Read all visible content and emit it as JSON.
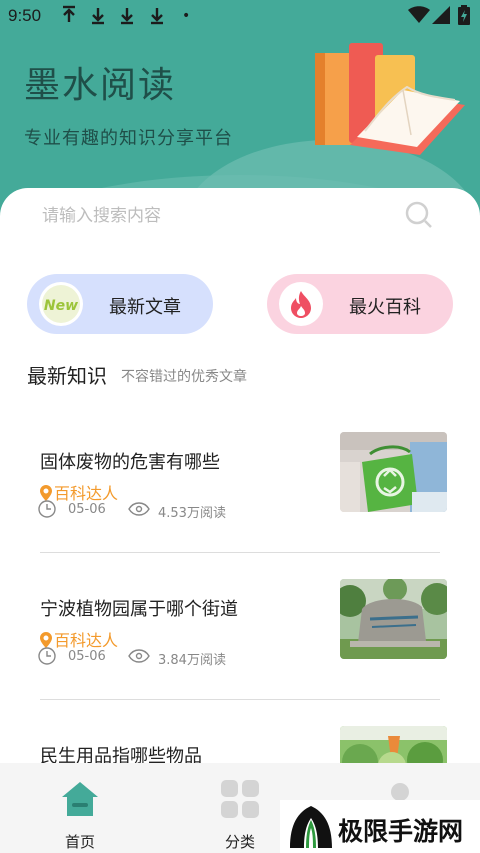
{
  "status_bar": {
    "time": "9:50",
    "icons": [
      "download-icon",
      "download-icon",
      "download-icon",
      "download-icon",
      "dot-icon",
      "wifi-icon",
      "signal-icon",
      "battery-icon"
    ],
    "dot": "•"
  },
  "header": {
    "title": "墨水阅读",
    "slogan": "专业有趣的知识分享平台",
    "background_color": "#44aa99"
  },
  "search": {
    "placeholder": "请输入搜索内容",
    "icon": "search-icon"
  },
  "categories": [
    {
      "label": "最新文章",
      "icon": "new-badge-icon",
      "icon_text": "New",
      "color": "#d6e0fd"
    },
    {
      "label": "最火百科",
      "icon": "fire-icon",
      "color": "#fbd3e0"
    }
  ],
  "section": {
    "title": "最新知识",
    "subtitle": "不容错过的优秀文章"
  },
  "articles": [
    {
      "title": "固体废物的危害有哪些",
      "author": "百科达人",
      "date": "05-06",
      "reads": "4.53万阅读",
      "thumb": "recycling-bag-photo"
    },
    {
      "title": "宁波植物园属于哪个街道",
      "author": "百科达人",
      "date": "05-06",
      "reads": "3.84万阅读",
      "thumb": "botanical-garden-stone-photo"
    },
    {
      "title": "民生用品指哪些物品",
      "thumb": "vegetables-photo"
    }
  ],
  "bottom_nav": [
    {
      "label": "首页",
      "icon": "home-icon",
      "active": true
    },
    {
      "label": "分类",
      "icon": "grid-icon",
      "active": false
    },
    {
      "label": "",
      "icon": "user-icon",
      "active": false
    }
  ],
  "watermark": {
    "text": "极限手游网"
  },
  "colors": {
    "accent": "#44aa99",
    "author": "#f39a2c",
    "fire": "#ef4f63"
  }
}
